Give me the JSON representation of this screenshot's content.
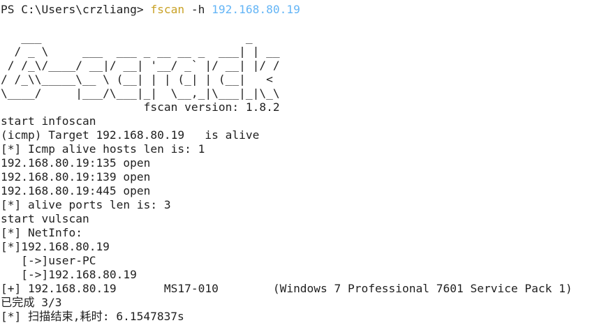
{
  "terminal": {
    "prompt": {
      "path": "PS C:\\Users\\crzliang> ",
      "command": "fscan",
      "flag": " -h ",
      "target": "192.168.80.19"
    },
    "banner": [
      "   ___                              _",
      "  / _ \\     ___  ___ _ __ __ _  ___| | __",
      " / /_\\/____/ __|/ __| '__/ _` |/ __| |/ /",
      "/ /_\\\\_____\\__ \\ (__| | | (_| | (__|   <",
      "\\____/     |___/\\___|_|  \\__,_|\\___|_|\\_\\"
    ],
    "version": "                     fscan version: 1.8.2",
    "output": [
      "start infoscan",
      "(icmp) Target 192.168.80.19   is alive",
      "[*] Icmp alive hosts len is: 1",
      "192.168.80.19:135 open",
      "192.168.80.19:139 open",
      "192.168.80.19:445 open",
      "[*] alive ports len is: 3",
      "start vulscan",
      "[*] NetInfo:",
      "[*]192.168.80.19",
      "   [->]user-PC",
      "   [->]192.168.80.19",
      "[+] 192.168.80.19       MS17-010        (Windows 7 Professional 7601 Service Pack 1)",
      "已完成 3/3",
      "[*] 扫描结束,耗时: 6.1547837s"
    ]
  },
  "colors": {
    "background": "#ffffff",
    "text": "#1f1f1f",
    "command": "#c9a227",
    "ip_argument": "#64b5f6"
  }
}
